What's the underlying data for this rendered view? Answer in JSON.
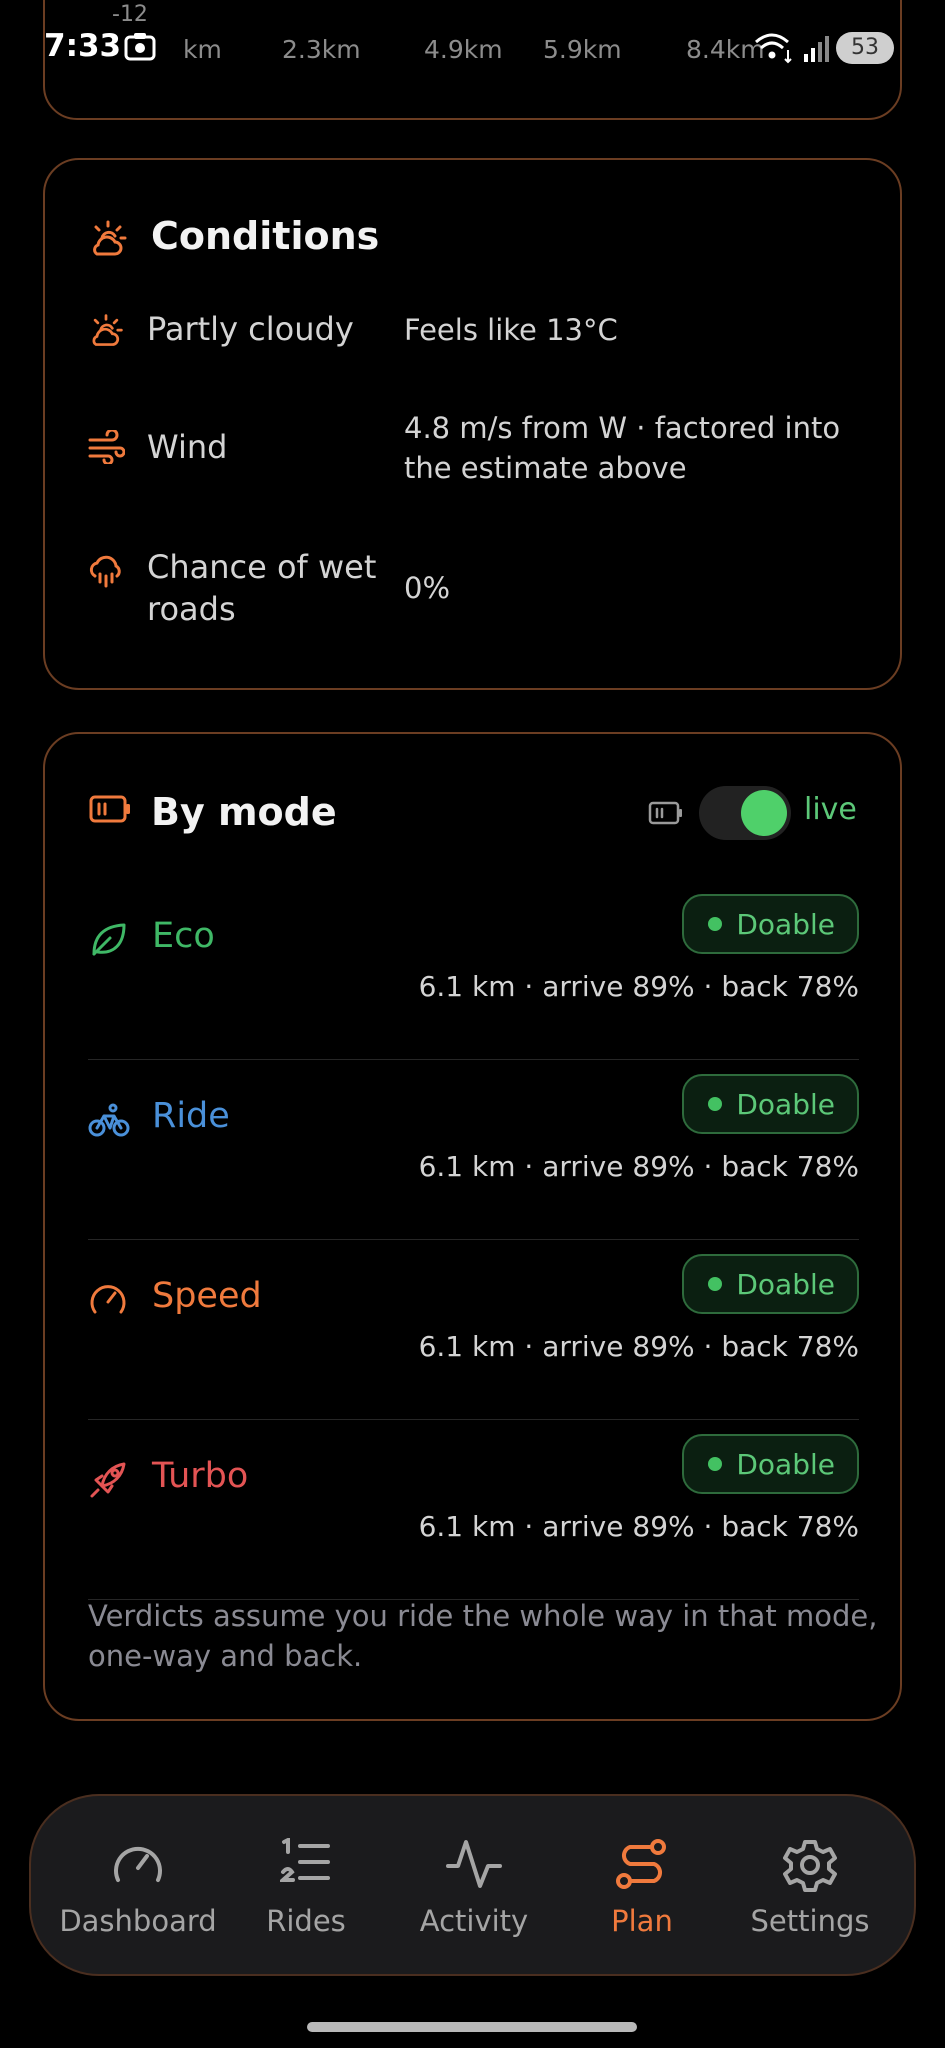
{
  "status_bar": {
    "time": "7:33",
    "battery": "53"
  },
  "elevation_strip": {
    "y_tick": "-12",
    "x_ticks": [
      "km",
      "2.3km",
      "4.9km",
      "5.9km",
      "8.4km"
    ]
  },
  "conditions": {
    "title": "Conditions",
    "rows": [
      {
        "icon": "partly-cloudy-icon",
        "label": "Partly cloudy",
        "value": "Feels like 13°C"
      },
      {
        "icon": "wind-icon",
        "label": "Wind",
        "value": "4.8 m/s from W · factored into the estimate above"
      },
      {
        "icon": "rain-cloud-icon",
        "label": "Chance of wet roads",
        "value": "0%"
      }
    ]
  },
  "by_mode": {
    "title": "By mode",
    "live_label": "live",
    "live_on": true,
    "modes": [
      {
        "name": "Eco",
        "color": "#3fb866",
        "icon": "leaf-icon",
        "verdict": "Doable",
        "stats": "6.1 km · arrive 89% · back 78%"
      },
      {
        "name": "Ride",
        "color": "#4a90d9",
        "icon": "bicycle-icon",
        "verdict": "Doable",
        "stats": "6.1 km · arrive 89% · back 78%"
      },
      {
        "name": "Speed",
        "color": "#f07a3d",
        "icon": "gauge-icon",
        "verdict": "Doable",
        "stats": "6.1 km · arrive 89% · back 78%"
      },
      {
        "name": "Turbo",
        "color": "#e35454",
        "icon": "rocket-icon",
        "verdict": "Doable",
        "stats": "6.1 km · arrive 89% · back 78%"
      }
    ],
    "footnote": "Verdicts assume you ride the whole way in that mode, one-way and back."
  },
  "nav": {
    "items": [
      {
        "label": "Dashboard",
        "icon": "gauge-icon",
        "active": false
      },
      {
        "label": "Rides",
        "icon": "numbered-list-icon",
        "active": false
      },
      {
        "label": "Activity",
        "icon": "pulse-icon",
        "active": false
      },
      {
        "label": "Plan",
        "icon": "route-icon",
        "active": true
      },
      {
        "label": "Settings",
        "icon": "gear-icon",
        "active": false
      }
    ]
  },
  "colors": {
    "accent": "#f07a3d",
    "card_border": "#6b3d22",
    "doable": "#5cc878"
  }
}
